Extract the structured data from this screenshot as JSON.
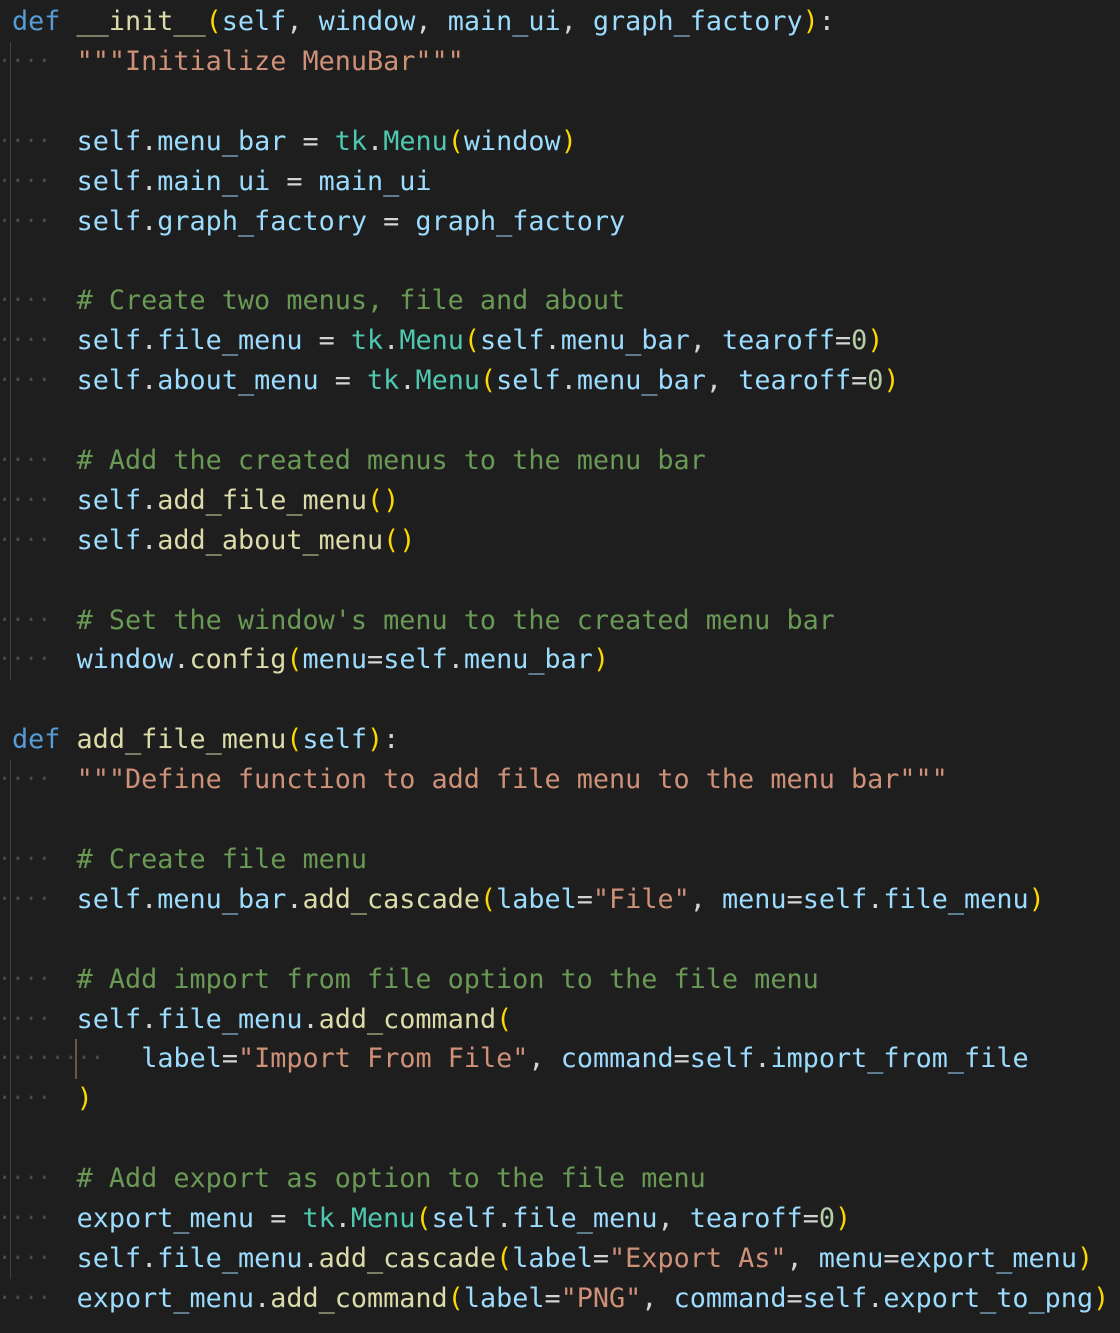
{
  "colors": {
    "background": "#1e1e1e",
    "keyword": "#569cd6",
    "function": "#dcdcaa",
    "variable": "#9cdcfe",
    "string": "#ce9178",
    "comment": "#6a9955",
    "class": "#4ec9b0",
    "number": "#b5cea8",
    "bracket": "#ffd700",
    "plain": "#d4d4d4",
    "whitespace_dot": "#4a4a4a",
    "indent_guide": "#404040"
  },
  "editor": {
    "lines": [
      {
        "indent": 0,
        "tokens": [
          [
            "kw",
            "def"
          ],
          [
            "plain",
            " "
          ],
          [
            "fn",
            "__init__"
          ],
          [
            "b1",
            "("
          ],
          [
            "param",
            "self"
          ],
          [
            "plain",
            ", "
          ],
          [
            "param",
            "window"
          ],
          [
            "plain",
            ", "
          ],
          [
            "param",
            "main_ui"
          ],
          [
            "plain",
            ", "
          ],
          [
            "param",
            "graph_factory"
          ],
          [
            "b1",
            ")"
          ],
          [
            "plain",
            ":"
          ]
        ]
      },
      {
        "indent": 1,
        "tokens": [
          [
            "str",
            "\"\"\"Initialize MenuBar\"\"\""
          ]
        ]
      },
      {
        "indent": -1,
        "tokens": []
      },
      {
        "indent": 1,
        "tokens": [
          [
            "param",
            "self"
          ],
          [
            "plain",
            "."
          ],
          [
            "param",
            "menu_bar"
          ],
          [
            "plain",
            " = "
          ],
          [
            "cls",
            "tk"
          ],
          [
            "plain",
            "."
          ],
          [
            "cls",
            "Menu"
          ],
          [
            "b1",
            "("
          ],
          [
            "param",
            "window"
          ],
          [
            "b1",
            ")"
          ]
        ]
      },
      {
        "indent": 1,
        "tokens": [
          [
            "param",
            "self"
          ],
          [
            "plain",
            "."
          ],
          [
            "param",
            "main_ui"
          ],
          [
            "plain",
            " = "
          ],
          [
            "param",
            "main_ui"
          ]
        ]
      },
      {
        "indent": 1,
        "tokens": [
          [
            "param",
            "self"
          ],
          [
            "plain",
            "."
          ],
          [
            "param",
            "graph_factory"
          ],
          [
            "plain",
            " = "
          ],
          [
            "param",
            "graph_factory"
          ]
        ]
      },
      {
        "indent": -1,
        "tokens": []
      },
      {
        "indent": 1,
        "tokens": [
          [
            "cm",
            "# Create two menus, file and about"
          ]
        ]
      },
      {
        "indent": 1,
        "tokens": [
          [
            "param",
            "self"
          ],
          [
            "plain",
            "."
          ],
          [
            "param",
            "file_menu"
          ],
          [
            "plain",
            " = "
          ],
          [
            "cls",
            "tk"
          ],
          [
            "plain",
            "."
          ],
          [
            "cls",
            "Menu"
          ],
          [
            "b1",
            "("
          ],
          [
            "param",
            "self"
          ],
          [
            "plain",
            "."
          ],
          [
            "param",
            "menu_bar"
          ],
          [
            "plain",
            ", "
          ],
          [
            "param",
            "tearoff"
          ],
          [
            "plain",
            "="
          ],
          [
            "num",
            "0"
          ],
          [
            "b1",
            ")"
          ]
        ]
      },
      {
        "indent": 1,
        "tokens": [
          [
            "param",
            "self"
          ],
          [
            "plain",
            "."
          ],
          [
            "param",
            "about_menu"
          ],
          [
            "plain",
            " = "
          ],
          [
            "cls",
            "tk"
          ],
          [
            "plain",
            "."
          ],
          [
            "cls",
            "Menu"
          ],
          [
            "b1",
            "("
          ],
          [
            "param",
            "self"
          ],
          [
            "plain",
            "."
          ],
          [
            "param",
            "menu_bar"
          ],
          [
            "plain",
            ", "
          ],
          [
            "param",
            "tearoff"
          ],
          [
            "plain",
            "="
          ],
          [
            "num",
            "0"
          ],
          [
            "b1",
            ")"
          ]
        ]
      },
      {
        "indent": -1,
        "tokens": []
      },
      {
        "indent": 1,
        "tokens": [
          [
            "cm",
            "# Add the created menus to the menu bar"
          ]
        ]
      },
      {
        "indent": 1,
        "tokens": [
          [
            "param",
            "self"
          ],
          [
            "plain",
            "."
          ],
          [
            "fn",
            "add_file_menu"
          ],
          [
            "b1",
            "()"
          ]
        ]
      },
      {
        "indent": 1,
        "tokens": [
          [
            "param",
            "self"
          ],
          [
            "plain",
            "."
          ],
          [
            "fn",
            "add_about_menu"
          ],
          [
            "b1",
            "()"
          ]
        ]
      },
      {
        "indent": -1,
        "tokens": []
      },
      {
        "indent": 1,
        "tokens": [
          [
            "cm",
            "# Set the window's menu to the created menu bar"
          ]
        ]
      },
      {
        "indent": 1,
        "tokens": [
          [
            "param",
            "window"
          ],
          [
            "plain",
            "."
          ],
          [
            "fn",
            "config"
          ],
          [
            "b1",
            "("
          ],
          [
            "param",
            "menu"
          ],
          [
            "plain",
            "="
          ],
          [
            "param",
            "self"
          ],
          [
            "plain",
            "."
          ],
          [
            "param",
            "menu_bar"
          ],
          [
            "b1",
            ")"
          ]
        ]
      },
      {
        "indent": -2,
        "tokens": []
      },
      {
        "indent": 0,
        "tokens": [
          [
            "kw",
            "def"
          ],
          [
            "plain",
            " "
          ],
          [
            "fn",
            "add_file_menu"
          ],
          [
            "b1",
            "("
          ],
          [
            "param",
            "self"
          ],
          [
            "b1",
            ")"
          ],
          [
            "plain",
            ":"
          ]
        ]
      },
      {
        "indent": 1,
        "tokens": [
          [
            "str",
            "\"\"\"Define function to add file menu to the menu bar\"\"\""
          ]
        ]
      },
      {
        "indent": -1,
        "tokens": []
      },
      {
        "indent": 1,
        "tokens": [
          [
            "cm",
            "# Create file menu"
          ]
        ]
      },
      {
        "indent": 1,
        "tokens": [
          [
            "param",
            "self"
          ],
          [
            "plain",
            "."
          ],
          [
            "param",
            "menu_bar"
          ],
          [
            "plain",
            "."
          ],
          [
            "fn",
            "add_cascade"
          ],
          [
            "b1",
            "("
          ],
          [
            "param",
            "label"
          ],
          [
            "plain",
            "="
          ],
          [
            "str",
            "\"File\""
          ],
          [
            "plain",
            ", "
          ],
          [
            "param",
            "menu"
          ],
          [
            "plain",
            "="
          ],
          [
            "param",
            "self"
          ],
          [
            "plain",
            "."
          ],
          [
            "param",
            "file_menu"
          ],
          [
            "b1",
            ")"
          ]
        ]
      },
      {
        "indent": -1,
        "tokens": []
      },
      {
        "indent": 1,
        "tokens": [
          [
            "cm",
            "# Add import from file option to the file menu"
          ]
        ]
      },
      {
        "indent": 1,
        "tokens": [
          [
            "param",
            "self"
          ],
          [
            "plain",
            "."
          ],
          [
            "param",
            "file_menu"
          ],
          [
            "plain",
            "."
          ],
          [
            "fn",
            "add_command"
          ],
          [
            "b1",
            "("
          ]
        ]
      },
      {
        "indent": 2,
        "tokens": [
          [
            "param",
            "label"
          ],
          [
            "plain",
            "="
          ],
          [
            "str",
            "\"Import From File\""
          ],
          [
            "plain",
            ", "
          ],
          [
            "param",
            "command"
          ],
          [
            "plain",
            "="
          ],
          [
            "param",
            "self"
          ],
          [
            "plain",
            "."
          ],
          [
            "param",
            "import_from_file"
          ]
        ]
      },
      {
        "indent": 1,
        "tokens": [
          [
            "b1",
            ")"
          ]
        ]
      },
      {
        "indent": -1,
        "tokens": []
      },
      {
        "indent": 1,
        "tokens": [
          [
            "cm",
            "# Add export as option to the file menu"
          ]
        ]
      },
      {
        "indent": 1,
        "tokens": [
          [
            "param",
            "export_menu"
          ],
          [
            "plain",
            " = "
          ],
          [
            "cls",
            "tk"
          ],
          [
            "plain",
            "."
          ],
          [
            "cls",
            "Menu"
          ],
          [
            "b1",
            "("
          ],
          [
            "param",
            "self"
          ],
          [
            "plain",
            "."
          ],
          [
            "param",
            "file_menu"
          ],
          [
            "plain",
            ", "
          ],
          [
            "param",
            "tearoff"
          ],
          [
            "plain",
            "="
          ],
          [
            "num",
            "0"
          ],
          [
            "b1",
            ")"
          ]
        ]
      },
      {
        "indent": 1,
        "tokens": [
          [
            "param",
            "self"
          ],
          [
            "plain",
            "."
          ],
          [
            "param",
            "file_menu"
          ],
          [
            "plain",
            "."
          ],
          [
            "fn",
            "add_cascade"
          ],
          [
            "b1",
            "("
          ],
          [
            "param",
            "label"
          ],
          [
            "plain",
            "="
          ],
          [
            "str",
            "\"Export As\""
          ],
          [
            "plain",
            ", "
          ],
          [
            "param",
            "menu"
          ],
          [
            "plain",
            "="
          ],
          [
            "param",
            "export_menu"
          ],
          [
            "b1",
            ")"
          ]
        ]
      },
      {
        "indent": 1,
        "tokens": [
          [
            "param",
            "export_menu"
          ],
          [
            "plain",
            "."
          ],
          [
            "fn",
            "add_command"
          ],
          [
            "b1",
            "("
          ],
          [
            "param",
            "label"
          ],
          [
            "plain",
            "="
          ],
          [
            "str",
            "\"PNG\""
          ],
          [
            "plain",
            ", "
          ],
          [
            "param",
            "command"
          ],
          [
            "plain",
            "="
          ],
          [
            "param",
            "self"
          ],
          [
            "plain",
            "."
          ],
          [
            "param",
            "export_to_png"
          ],
          [
            "b1",
            ")"
          ]
        ]
      }
    ]
  }
}
